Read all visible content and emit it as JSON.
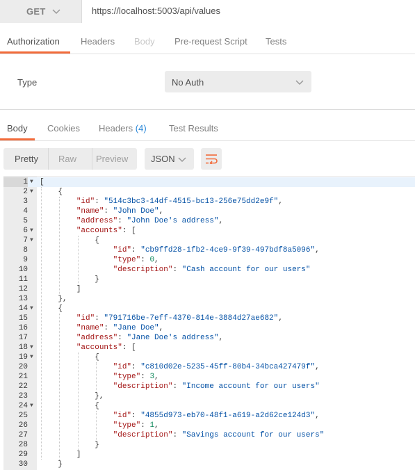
{
  "request": {
    "method": "GET",
    "url": "https://localhost:5003/api/values",
    "tabs": [
      "Authorization",
      "Headers",
      "Body",
      "Pre-request Script",
      "Tests"
    ],
    "active_tab": "Authorization"
  },
  "auth": {
    "type_label": "Type",
    "type_value": "No Auth"
  },
  "response": {
    "tabs": {
      "body": "Body",
      "cookies": "Cookies",
      "headers": "Headers",
      "headers_count": "(4)",
      "test_results": "Test Results"
    },
    "active_tab": "Body",
    "view_modes": [
      "Pretty",
      "Raw",
      "Preview"
    ],
    "active_view": "Pretty",
    "format": "JSON"
  },
  "colors": {
    "accent": "#f26b3a",
    "badge": "#2b88d8",
    "json_key": "#a31515",
    "json_string": "#0451a5",
    "json_number": "#098658"
  },
  "icons": {
    "method_dropdown": "chevron-down-icon",
    "auth_dropdown": "chevron-down-icon",
    "format_dropdown": "chevron-down-icon",
    "wrap": "wrap-lines-icon",
    "fold": "fold-arrow-icon"
  },
  "body_lines": [
    {
      "n": "1",
      "fold": true,
      "indent": 0,
      "parts": [
        [
          "p",
          "["
        ]
      ]
    },
    {
      "n": "2",
      "fold": true,
      "indent": 1,
      "parts": [
        [
          "p",
          "{"
        ]
      ]
    },
    {
      "n": "3",
      "fold": false,
      "indent": 2,
      "parts": [
        [
          "k",
          "\"id\""
        ],
        [
          "p",
          ": "
        ],
        [
          "s",
          "\"514c3bc3-14df-4515-bc13-256e75dd2e9f\""
        ],
        [
          "p",
          ","
        ]
      ]
    },
    {
      "n": "4",
      "fold": false,
      "indent": 2,
      "parts": [
        [
          "k",
          "\"name\""
        ],
        [
          "p",
          ": "
        ],
        [
          "s",
          "\"John Doe\""
        ],
        [
          "p",
          ","
        ]
      ]
    },
    {
      "n": "5",
      "fold": false,
      "indent": 2,
      "parts": [
        [
          "k",
          "\"address\""
        ],
        [
          "p",
          ": "
        ],
        [
          "s",
          "\"John Doe's address\""
        ],
        [
          "p",
          ","
        ]
      ]
    },
    {
      "n": "6",
      "fold": true,
      "indent": 2,
      "parts": [
        [
          "k",
          "\"accounts\""
        ],
        [
          "p",
          ": ["
        ]
      ]
    },
    {
      "n": "7",
      "fold": true,
      "indent": 3,
      "parts": [
        [
          "p",
          "{"
        ]
      ]
    },
    {
      "n": "8",
      "fold": false,
      "indent": 4,
      "parts": [
        [
          "k",
          "\"id\""
        ],
        [
          "p",
          ": "
        ],
        [
          "s",
          "\"cb9ffd28-1fb2-4ce9-9f39-497bdf8a5096\""
        ],
        [
          "p",
          ","
        ]
      ]
    },
    {
      "n": "9",
      "fold": false,
      "indent": 4,
      "parts": [
        [
          "k",
          "\"type\""
        ],
        [
          "p",
          ": "
        ],
        [
          "n",
          "0"
        ],
        [
          "p",
          ","
        ]
      ]
    },
    {
      "n": "10",
      "fold": false,
      "indent": 4,
      "parts": [
        [
          "k",
          "\"description\""
        ],
        [
          "p",
          ": "
        ],
        [
          "s",
          "\"Cash account for our users\""
        ]
      ]
    },
    {
      "n": "11",
      "fold": false,
      "indent": 3,
      "parts": [
        [
          "p",
          "}"
        ]
      ]
    },
    {
      "n": "12",
      "fold": false,
      "indent": 2,
      "parts": [
        [
          "p",
          "]"
        ]
      ]
    },
    {
      "n": "13",
      "fold": false,
      "indent": 1,
      "parts": [
        [
          "p",
          "},"
        ]
      ]
    },
    {
      "n": "14",
      "fold": true,
      "indent": 1,
      "parts": [
        [
          "p",
          "{"
        ]
      ]
    },
    {
      "n": "15",
      "fold": false,
      "indent": 2,
      "parts": [
        [
          "k",
          "\"id\""
        ],
        [
          "p",
          ": "
        ],
        [
          "s",
          "\"791716be-7eff-4370-814e-3884d27ae682\""
        ],
        [
          "p",
          ","
        ]
      ]
    },
    {
      "n": "16",
      "fold": false,
      "indent": 2,
      "parts": [
        [
          "k",
          "\"name\""
        ],
        [
          "p",
          ": "
        ],
        [
          "s",
          "\"Jane Doe\""
        ],
        [
          "p",
          ","
        ]
      ]
    },
    {
      "n": "17",
      "fold": false,
      "indent": 2,
      "parts": [
        [
          "k",
          "\"address\""
        ],
        [
          "p",
          ": "
        ],
        [
          "s",
          "\"Jane Doe's address\""
        ],
        [
          "p",
          ","
        ]
      ]
    },
    {
      "n": "18",
      "fold": true,
      "indent": 2,
      "parts": [
        [
          "k",
          "\"accounts\""
        ],
        [
          "p",
          ": ["
        ]
      ]
    },
    {
      "n": "19",
      "fold": true,
      "indent": 3,
      "parts": [
        [
          "p",
          "{"
        ]
      ]
    },
    {
      "n": "20",
      "fold": false,
      "indent": 4,
      "parts": [
        [
          "k",
          "\"id\""
        ],
        [
          "p",
          ": "
        ],
        [
          "s",
          "\"c810d02e-5235-45ff-80b4-34bca427479f\""
        ],
        [
          "p",
          ","
        ]
      ]
    },
    {
      "n": "21",
      "fold": false,
      "indent": 4,
      "parts": [
        [
          "k",
          "\"type\""
        ],
        [
          "p",
          ": "
        ],
        [
          "n",
          "3"
        ],
        [
          "p",
          ","
        ]
      ]
    },
    {
      "n": "22",
      "fold": false,
      "indent": 4,
      "parts": [
        [
          "k",
          "\"description\""
        ],
        [
          "p",
          ": "
        ],
        [
          "s",
          "\"Income account for our users\""
        ]
      ]
    },
    {
      "n": "23",
      "fold": false,
      "indent": 3,
      "parts": [
        [
          "p",
          "},"
        ]
      ]
    },
    {
      "n": "24",
      "fold": true,
      "indent": 3,
      "parts": [
        [
          "p",
          "{"
        ]
      ]
    },
    {
      "n": "25",
      "fold": false,
      "indent": 4,
      "parts": [
        [
          "k",
          "\"id\""
        ],
        [
          "p",
          ": "
        ],
        [
          "s",
          "\"4855d973-eb70-48f1-a619-a2d62ce124d3\""
        ],
        [
          "p",
          ","
        ]
      ]
    },
    {
      "n": "26",
      "fold": false,
      "indent": 4,
      "parts": [
        [
          "k",
          "\"type\""
        ],
        [
          "p",
          ": "
        ],
        [
          "n",
          "1"
        ],
        [
          "p",
          ","
        ]
      ]
    },
    {
      "n": "27",
      "fold": false,
      "indent": 4,
      "parts": [
        [
          "k",
          "\"description\""
        ],
        [
          "p",
          ": "
        ],
        [
          "s",
          "\"Savings account for our users\""
        ]
      ]
    },
    {
      "n": "28",
      "fold": false,
      "indent": 3,
      "parts": [
        [
          "p",
          "}"
        ]
      ]
    },
    {
      "n": "29",
      "fold": false,
      "indent": 2,
      "parts": [
        [
          "p",
          "]"
        ]
      ]
    },
    {
      "n": "30",
      "fold": false,
      "indent": 1,
      "parts": [
        [
          "p",
          "}"
        ]
      ]
    }
  ]
}
